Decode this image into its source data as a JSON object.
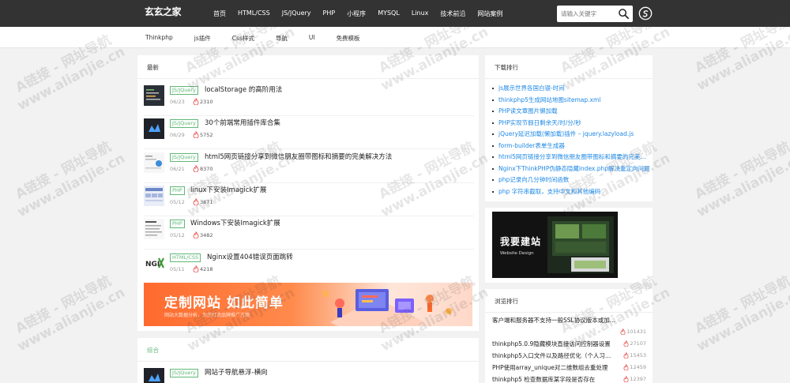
{
  "header": {
    "logo": "玄玄之家",
    "nav": [
      "首页",
      "HTML/CSS",
      "JS/JQuery",
      "PHP",
      "小程序",
      "MYSQL",
      "Linux",
      "技术前沿",
      "网站案例"
    ],
    "search": {
      "placeholder": "请输入关键字",
      "icon": "search-icon"
    },
    "user_icon": "user-circle-icon"
  },
  "subnav": [
    "Thinkphp",
    "js插件",
    "Css样式",
    "导航",
    "UI",
    "免费模板"
  ],
  "latest": {
    "title": "最新",
    "articles": [
      {
        "tag": "JS/JQuery",
        "title": "localStorage 的高阶用法",
        "date": "06/23",
        "hits": "2310"
      },
      {
        "tag": "JS/JQuery",
        "title": "30个前端常用插件库合集",
        "date": "06/29",
        "hits": "5752"
      },
      {
        "tag": "JS/JQuery",
        "title": "html5网页链接分享到微信朋友圈带图标和摘要的完美解决方法",
        "date": "06/21",
        "hits": "8370"
      },
      {
        "tag": "PHP",
        "title": "linux下安装Imagick扩展",
        "date": "05/12",
        "hits": "3871"
      },
      {
        "tag": "PHP",
        "title": "Windows下安装Imagick扩展",
        "date": "05/12",
        "hits": "3482"
      },
      {
        "tag": "HTML/CSS",
        "title": "Nginx设置404错误页面跳转",
        "date": "05/11",
        "hits": "4218"
      }
    ]
  },
  "banner": {
    "title": "定制网站 如此简单",
    "subtitle": "网站大数据分析，为您打造品牌推广方案"
  },
  "mixed": {
    "title": "综合",
    "articles": [
      {
        "tag": "JS/JQuery",
        "title": "网站子导航悬浮-横向",
        "date": "",
        "hits": ""
      }
    ]
  },
  "downloads": {
    "title": "下载排行",
    "items": [
      "js展示世界各国白银-时间",
      "thinkphp5生成网站地图sitemap.xml",
      "PHP读文章图片懒加载",
      "PHP实现节假日剩余天/时/分/秒",
      "jQuery延迟加载(懒加载)插件 – jquery.lazyload.js",
      "form-builder表单生成器",
      "html5网页链接分享到微信朋友圈带图标和摘要的完美解决方法",
      "Nginx下ThinkPHP伪静态隐藏index.php解决重定向问题",
      "php记录向几分钟时间函数",
      "php 字符串截取，支持中文和其他编码"
    ]
  },
  "ad": {
    "title": "我要建站",
    "subtitle": "Website Design"
  },
  "browse": {
    "title": "浏览排行",
    "items": [
      {
        "title": "客户端和服务器不支持一般SSL协议版本或加...",
        "hits": "101431"
      },
      {
        "title": "thinkphp5.0.9隐藏模块直接访问控制器设置",
        "hits": "27107"
      },
      {
        "title": "thinkphp5入口文件以及路径优化（个人习惯）",
        "hits": "15453"
      },
      {
        "title": "PHP使用array_unique对二维数组去重处理",
        "hits": "12459"
      },
      {
        "title": "thinkphp5 检查数据库某字段是否存在",
        "hits": "12397"
      }
    ]
  },
  "watermark": [
    "A链接 - 网址导航",
    "www.alianjie.cn"
  ],
  "colors": {
    "topbar": "#333333",
    "accent_green": "#5fb878",
    "link_blue": "#1e88e5",
    "flame_red": "#e53935"
  }
}
